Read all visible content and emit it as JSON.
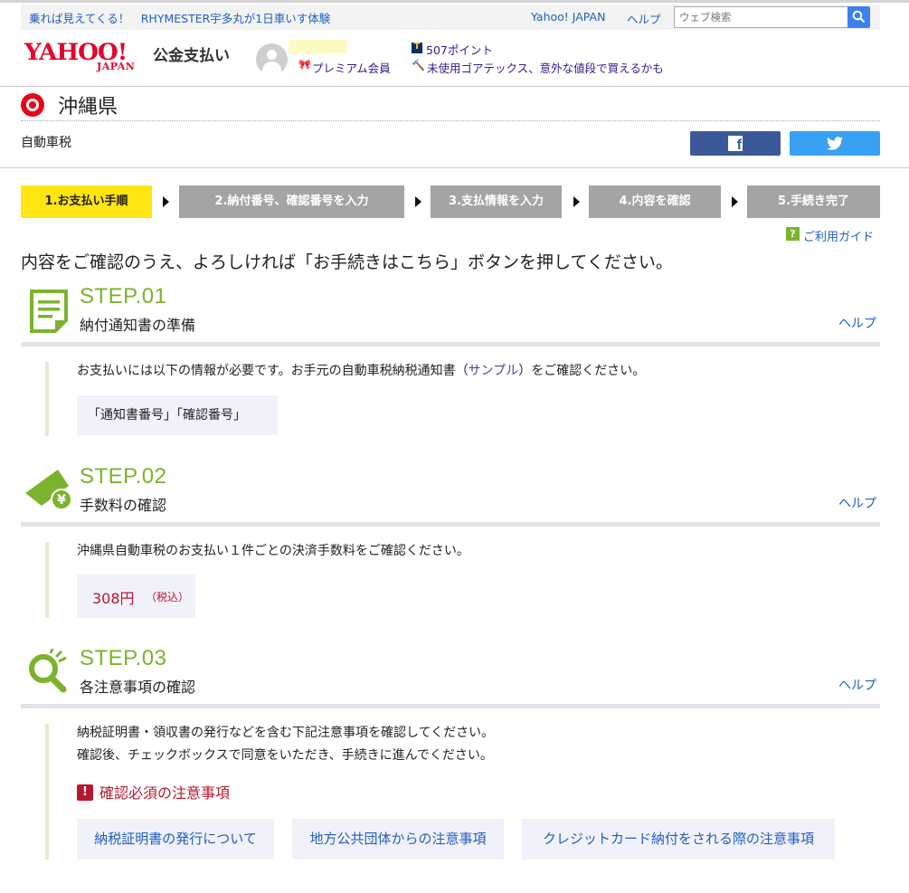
{
  "topbar": {
    "promo": "乗れば見えてくる！　RHYMESTER宇多丸が1日車いす体験",
    "yahoo_link": "Yahoo! JAPAN",
    "help_link": "ヘルプ",
    "search_placeholder": "ウェブ検索"
  },
  "header": {
    "logo_main": "YAHOO!",
    "logo_sub": "JAPAN",
    "service": "公金支払い",
    "premium": "プレミアム会員",
    "points": "507ポイント",
    "auction_promo": "未使用ゴアテックス、意外な値段で買えるかも"
  },
  "page": {
    "prefecture": "沖縄県",
    "tax_type": "自動車税"
  },
  "steps": [
    {
      "label": "1.お支払い手順",
      "active": true
    },
    {
      "label": "2.納付番号、確認番号を入力",
      "active": false
    },
    {
      "label": "3.支払情報を入力",
      "active": false
    },
    {
      "label": "4.内容を確認",
      "active": false
    },
    {
      "label": "5.手続き完了",
      "active": false
    }
  ],
  "guide": {
    "icon": "?",
    "label": "ご利用ガイド"
  },
  "instruction": "内容をご確認のうえ、よろしければ「お手続きはこちら」ボタンを押してください。",
  "sections": {
    "step1": {
      "label": "STEP.01",
      "title": "納付通知書の準備",
      "help": "ヘルプ",
      "text_before": "お支払いには以下の情報が必要です。お手元の自動車税納税通知書（",
      "sample_link": "サンプル",
      "text_after": "）をご確認ください。",
      "box": "「通知書番号」「確認番号」"
    },
    "step2": {
      "label": "STEP.02",
      "title": "手数料の確認",
      "help": "ヘルプ",
      "text": "沖縄県自動車税のお支払い１件ごとの決済手数料をご確認ください。",
      "fee": "308円",
      "fee_note": "（税込）"
    },
    "step3": {
      "label": "STEP.03",
      "title": "各注意事項の確認",
      "help": "ヘルプ",
      "text_line1": "納税証明書・領収書の発行などを含む下記注意事項を確認してください。",
      "text_line2": "確認後、チェックボックスで同意をいただき、手続きに進んでください。",
      "warn_icon": "!",
      "warn_title": "確認必須の注意事項",
      "buttons": [
        "納税証明書の発行について",
        "地方公共団体からの注意事項",
        "クレジットカード納付をされる際の注意事項"
      ]
    }
  },
  "colors": {
    "accent_green": "#7bb32e",
    "active_step": "#ffe512",
    "inactive_step": "#a4a4a4",
    "link_blue": "#2060c0",
    "alert_red": "#b7182f",
    "facebook": "#3b5998",
    "twitter": "#38a1f3"
  }
}
